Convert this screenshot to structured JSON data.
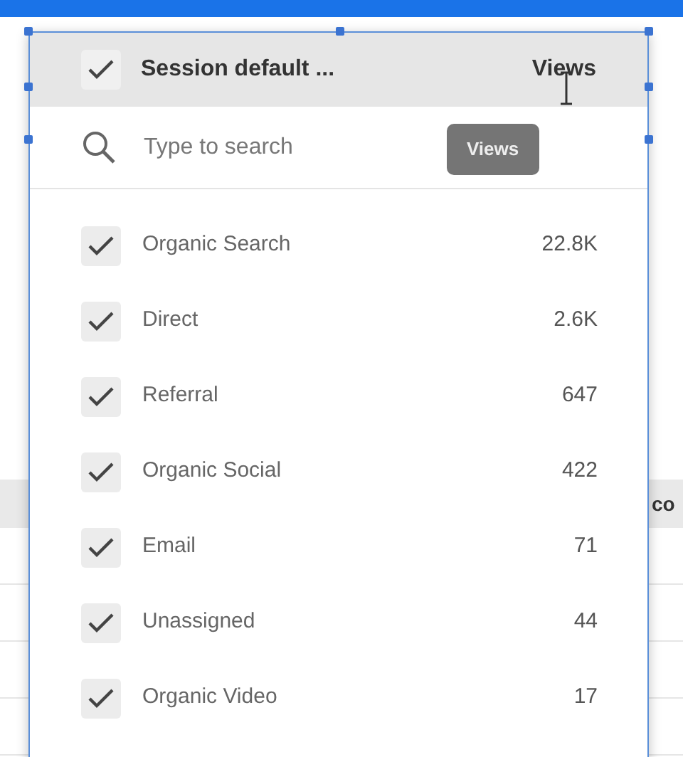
{
  "header": {
    "label": "Session default ...",
    "checked": true,
    "metric": "Views"
  },
  "search": {
    "placeholder": "Type to search"
  },
  "tooltip": {
    "text": "Views"
  },
  "items": [
    {
      "label": "Organic Search",
      "value": "22.8K",
      "checked": true
    },
    {
      "label": "Direct",
      "value": "2.6K",
      "checked": true
    },
    {
      "label": "Referral",
      "value": "647",
      "checked": true
    },
    {
      "label": "Organic Social",
      "value": "422",
      "checked": true
    },
    {
      "label": "Email",
      "value": "71",
      "checked": true
    },
    {
      "label": "Unassigned",
      "value": "44",
      "checked": true
    },
    {
      "label": "Organic Video",
      "value": "17",
      "checked": true
    }
  ],
  "background_table": {
    "column_header": "co"
  }
}
